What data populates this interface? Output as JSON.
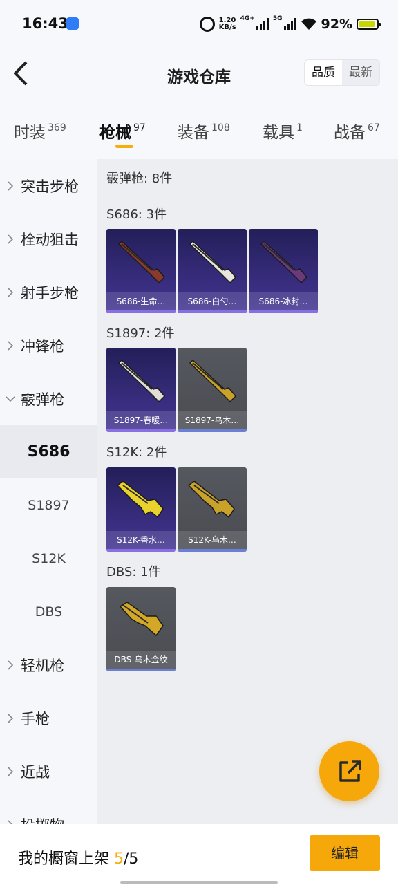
{
  "status_bar": {
    "time": "16:43",
    "speed_value": "1.20",
    "speed_unit": "KB/s",
    "net1": "4G+",
    "net2": "5G",
    "battery": "92%"
  },
  "header": {
    "title": "游戏仓库",
    "sort_options": [
      "品质",
      "最新"
    ],
    "sort_active": "品质"
  },
  "category_tabs": [
    {
      "label": "时装",
      "count": "369"
    },
    {
      "label": "枪械",
      "count": "97",
      "active": true
    },
    {
      "label": "装备",
      "count": "108"
    },
    {
      "label": "载具",
      "count": "1"
    },
    {
      "label": "战备",
      "count": "67"
    }
  ],
  "sidebar": {
    "groups": [
      {
        "label": "突击步枪"
      },
      {
        "label": "栓动狙击"
      },
      {
        "label": "射手步枪"
      },
      {
        "label": "冲锋枪"
      },
      {
        "label": "霰弹枪",
        "expanded": true
      },
      {
        "label": "轻机枪"
      },
      {
        "label": "手枪"
      },
      {
        "label": "近战"
      },
      {
        "label": "投掷物"
      }
    ],
    "subitems": [
      {
        "label": "S686",
        "active": true
      },
      {
        "label": "S1897"
      },
      {
        "label": "S12K"
      },
      {
        "label": "DBS"
      }
    ]
  },
  "content": {
    "category_summary": "霰弹枪: 8件",
    "sections": [
      {
        "title": "S686: 3件",
        "items": [
          {
            "name": "S686-生命…",
            "rarity": "purple",
            "gun_color": "#8a3a2a"
          },
          {
            "name": "S686-白勺…",
            "rarity": "purple",
            "gun_color": "#e9e4dc"
          },
          {
            "name": "S686-冰封…",
            "rarity": "purple",
            "gun_color": "#6a3a7a"
          }
        ]
      },
      {
        "title": "S1897: 2件",
        "items": [
          {
            "name": "S1897-春暖…",
            "rarity": "purple",
            "gun_color": "#e2ddd5"
          },
          {
            "name": "S1897-乌木…",
            "rarity": "gray",
            "gun_color": "#c9a22a"
          }
        ]
      },
      {
        "title": "S12K: 2件",
        "items": [
          {
            "name": "S12K-香水…",
            "rarity": "purple",
            "gun_color": "#e9d12e"
          },
          {
            "name": "S12K-乌木…",
            "rarity": "gray",
            "gun_color": "#c9a22a"
          }
        ]
      },
      {
        "title": "DBS: 1件",
        "items": [
          {
            "name": "DBS-乌木金纹",
            "rarity": "gray",
            "gun_color": "#d4a827"
          }
        ]
      }
    ]
  },
  "bottom_bar": {
    "label_prefix": "我的橱窗上架 ",
    "count_current": "5",
    "count_total": "/5",
    "edit_label": "编辑"
  },
  "colors": {
    "accent": "#f6a80a",
    "purple_card": "#372c7c",
    "gray_card": "#4f5157"
  }
}
